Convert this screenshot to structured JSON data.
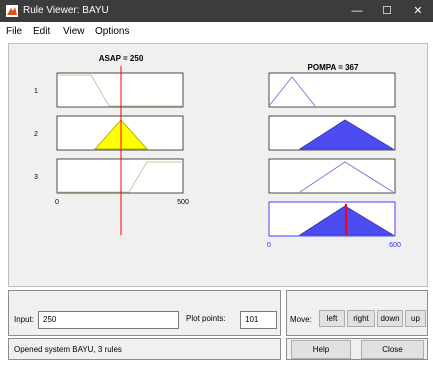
{
  "window": {
    "title": "Rule Viewer: BAYU",
    "controls": {
      "minimize": "—",
      "maximize": "☐",
      "close": "✕"
    }
  },
  "menu": [
    "File",
    "Edit",
    "View",
    "Options"
  ],
  "input_panel": {
    "title": "ASAP = 250",
    "range": [
      "0",
      "500"
    ],
    "rules": [
      "1",
      "2",
      "3"
    ]
  },
  "output_panel": {
    "title": "POMPA = 367",
    "range": [
      "0",
      "600"
    ]
  },
  "controls": {
    "input_label": "Input:",
    "input_value": "250",
    "plot_points_label": "Plot points:",
    "plot_points_value": "101",
    "move_label": "Move:",
    "move_buttons": [
      "left",
      "right",
      "down",
      "up"
    ],
    "status": "Opened system BAYU, 3 rules",
    "help": "Help",
    "close": "Close"
  },
  "colors": {
    "title_bar": "#3c3c3c",
    "input_fill": "#ffff00",
    "output_fill": "#4c4cf0",
    "index_line": "#ff0000",
    "mf_line": "#c8c8a0",
    "out_line": "#7d7dd7"
  }
}
